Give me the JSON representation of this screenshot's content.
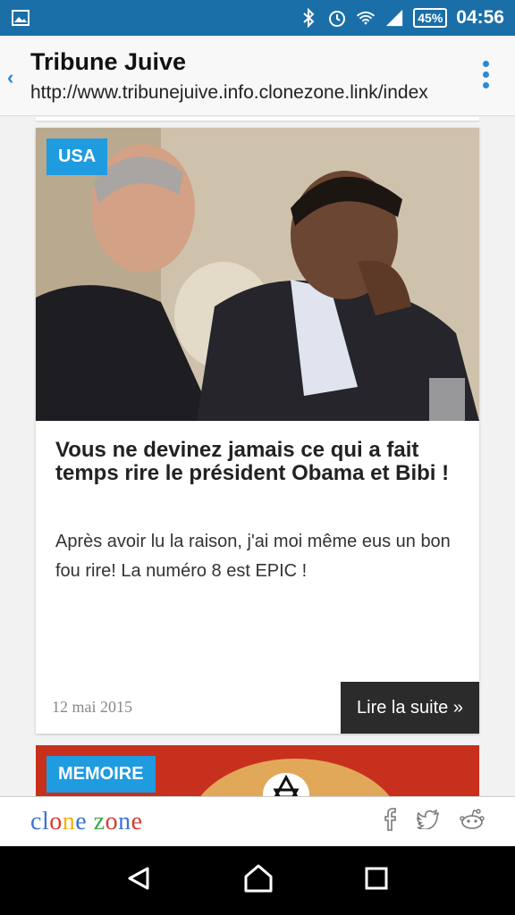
{
  "statusbar": {
    "battery": "45%",
    "time": "04:56",
    "icons": [
      "image-icon",
      "bluetooth-icon",
      "alarm-icon",
      "wifi-icon",
      "signal-icon",
      "battery-icon"
    ]
  },
  "toolbar": {
    "title": "Tribune Juive",
    "url": "http://www.tribunejuive.info.clonezone.link/index"
  },
  "article": {
    "tag": "USA",
    "headline": "Vous ne devinez jamais ce qui a fait temps rire le président Obama et Bibi !",
    "excerpt": "Après avoir lu la raison, j'ai moi même eus un bon fou rire! La numéro 8 est EPIC !",
    "date": "12 mai 2015",
    "read_more": "Lire la suite »"
  },
  "next_article": {
    "tag": "MEMOIRE"
  },
  "footer": {
    "brand_letters": [
      {
        "ch": "c",
        "color": "#3b73d6"
      },
      {
        "ch": "l",
        "color": "#3b73d6"
      },
      {
        "ch": "o",
        "color": "#d93a2b"
      },
      {
        "ch": "n",
        "color": "#f2b200"
      },
      {
        "ch": "e",
        "color": "#3b73d6"
      },
      {
        "ch": " ",
        "color": "#000000"
      },
      {
        "ch": "z",
        "color": "#3ea84a"
      },
      {
        "ch": "o",
        "color": "#d93a2b"
      },
      {
        "ch": "n",
        "color": "#3b73d6"
      },
      {
        "ch": "e",
        "color": "#d93a2b"
      }
    ],
    "social_icons": [
      "facebook-icon",
      "twitter-icon",
      "reddit-icon"
    ]
  },
  "colors": {
    "statusbar": "#1a6fa8",
    "tag": "#1f9be0",
    "readmore": "#2b2b2b",
    "accent": "#2a8ad6"
  }
}
